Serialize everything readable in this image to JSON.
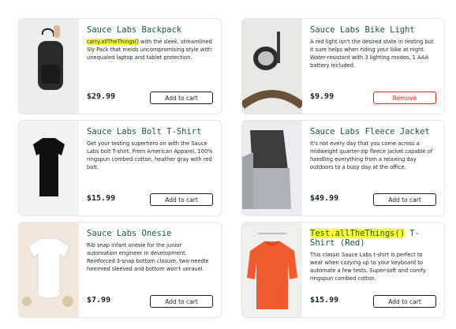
{
  "products": [
    {
      "title": "Sauce Labs Backpack",
      "desc_highlight": "carry.allTheThings()",
      "desc_rest": " with the sleek, streamlined Sly Pack that melds uncompromising style with unequaled laptop and tablet protection.",
      "price": "$29.99",
      "button": "Add to cart"
    },
    {
      "title": "Sauce Labs Bike Light",
      "desc_highlight": "",
      "desc_rest": "A red light isn't the desired state in testing but it sure helps when riding your bike at night. Water-resistant with 3 lighting modes, 1 AAA battery included.",
      "price": "$9.99",
      "button": "Remove"
    },
    {
      "title": "Sauce Labs Bolt T-Shirt",
      "desc_highlight": "",
      "desc_rest": "Get your testing superhero on with the Sauce Labs bolt T-shirt. From American Apparel, 100% ringspun combed cotton, heather gray with red bolt.",
      "price": "$15.99",
      "button": "Add to cart"
    },
    {
      "title": "Sauce Labs Fleece Jacket",
      "desc_highlight": "",
      "desc_rest": "It's not every day that you come across a midweight quarter-zip fleece jacket capable of handling everything from a relaxing day outdoors to a busy day at the office.",
      "price": "$49.99",
      "button": "Add to cart"
    },
    {
      "title": "Sauce Labs Onesie",
      "desc_highlight": "",
      "desc_rest": "Rib snap infant onesie for the junior automation engineer in development. Reinforced 3-snap bottom closure, two-needle hemmed sleeved and bottom won't unravel.",
      "price": "$7.99",
      "button": "Add to cart"
    },
    {
      "title_highlight": "Test.allTheThings()",
      "title": " T-Shirt (Red)",
      "desc_highlight": "",
      "desc_rest": "This classic Sauce Labs t-shirt is perfect to wear when cozying up to your keyboard to automate a few tests. Super-soft and comfy ringspun combed cotton.",
      "price": "$15.99",
      "button": "Add to cart"
    }
  ],
  "colors": {
    "title": "#18583a",
    "highlight": "#fbff3a",
    "remove": "#e2231a"
  }
}
